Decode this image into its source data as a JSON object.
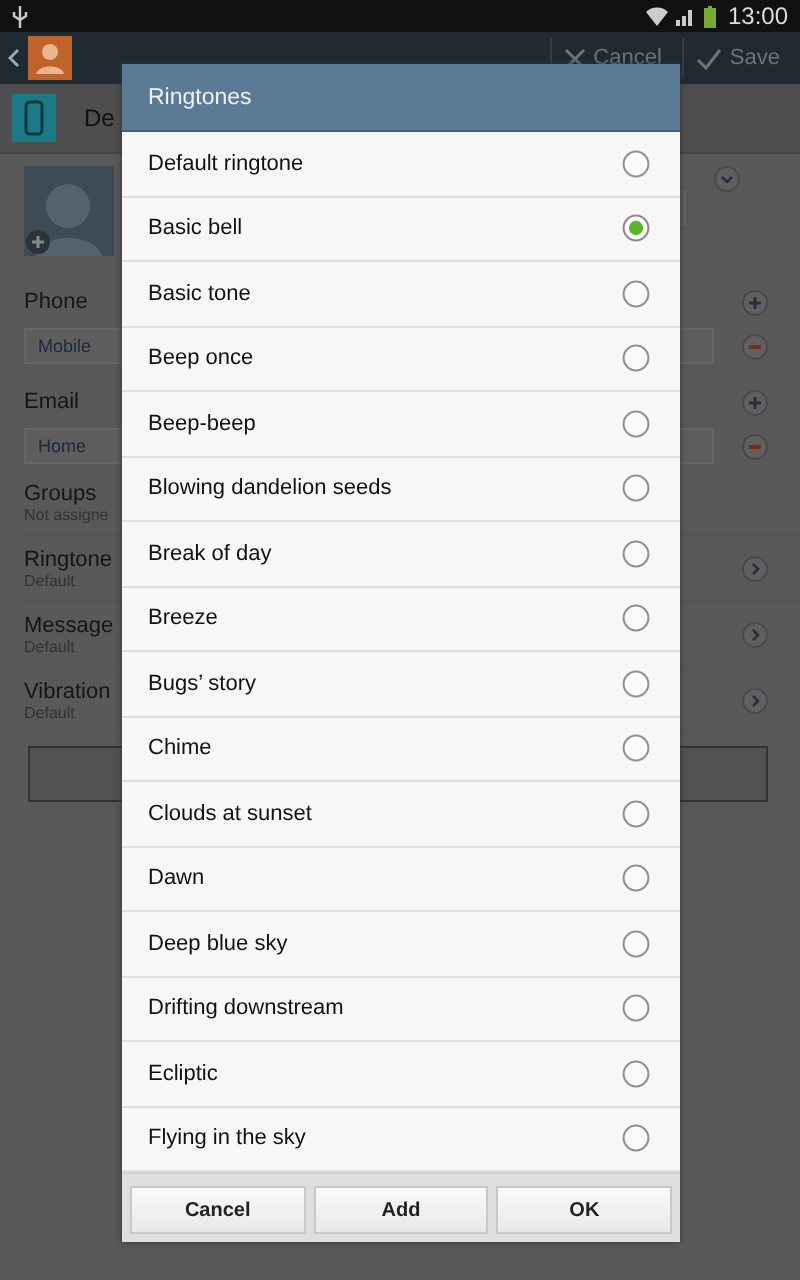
{
  "status_bar": {
    "time": "13:00"
  },
  "action_bar": {
    "cancel": "Cancel",
    "save": "Save"
  },
  "account": {
    "label": "De"
  },
  "form": {
    "phone": {
      "label": "Phone",
      "type": "Mobile"
    },
    "email": {
      "label": "Email",
      "type": "Home"
    },
    "settings": [
      {
        "label": "Groups",
        "value": "Not assigne",
        "kind": "plain"
      },
      {
        "label": "Ringtone",
        "value": "Default",
        "kind": "link"
      },
      {
        "label": "Message",
        "value": "Default",
        "kind": "link"
      },
      {
        "label": "Vibration",
        "value": "Default",
        "kind": "link"
      }
    ]
  },
  "dialog": {
    "title": "Ringtones",
    "options": [
      {
        "label": "Default ringtone",
        "selected": false
      },
      {
        "label": "Basic bell",
        "selected": true
      },
      {
        "label": "Basic tone",
        "selected": false
      },
      {
        "label": "Beep once",
        "selected": false
      },
      {
        "label": "Beep-beep",
        "selected": false
      },
      {
        "label": "Blowing dandelion seeds",
        "selected": false
      },
      {
        "label": "Break of day",
        "selected": false
      },
      {
        "label": "Breeze",
        "selected": false
      },
      {
        "label": "Bugs’ story",
        "selected": false
      },
      {
        "label": "Chime",
        "selected": false
      },
      {
        "label": "Clouds at sunset",
        "selected": false
      },
      {
        "label": "Dawn",
        "selected": false
      },
      {
        "label": "Deep blue sky",
        "selected": false
      },
      {
        "label": "Drifting downstream",
        "selected": false
      },
      {
        "label": "Ecliptic",
        "selected": false
      },
      {
        "label": "Flying in the sky",
        "selected": false
      }
    ],
    "buttons": [
      "Cancel",
      "Add",
      "OK"
    ]
  }
}
